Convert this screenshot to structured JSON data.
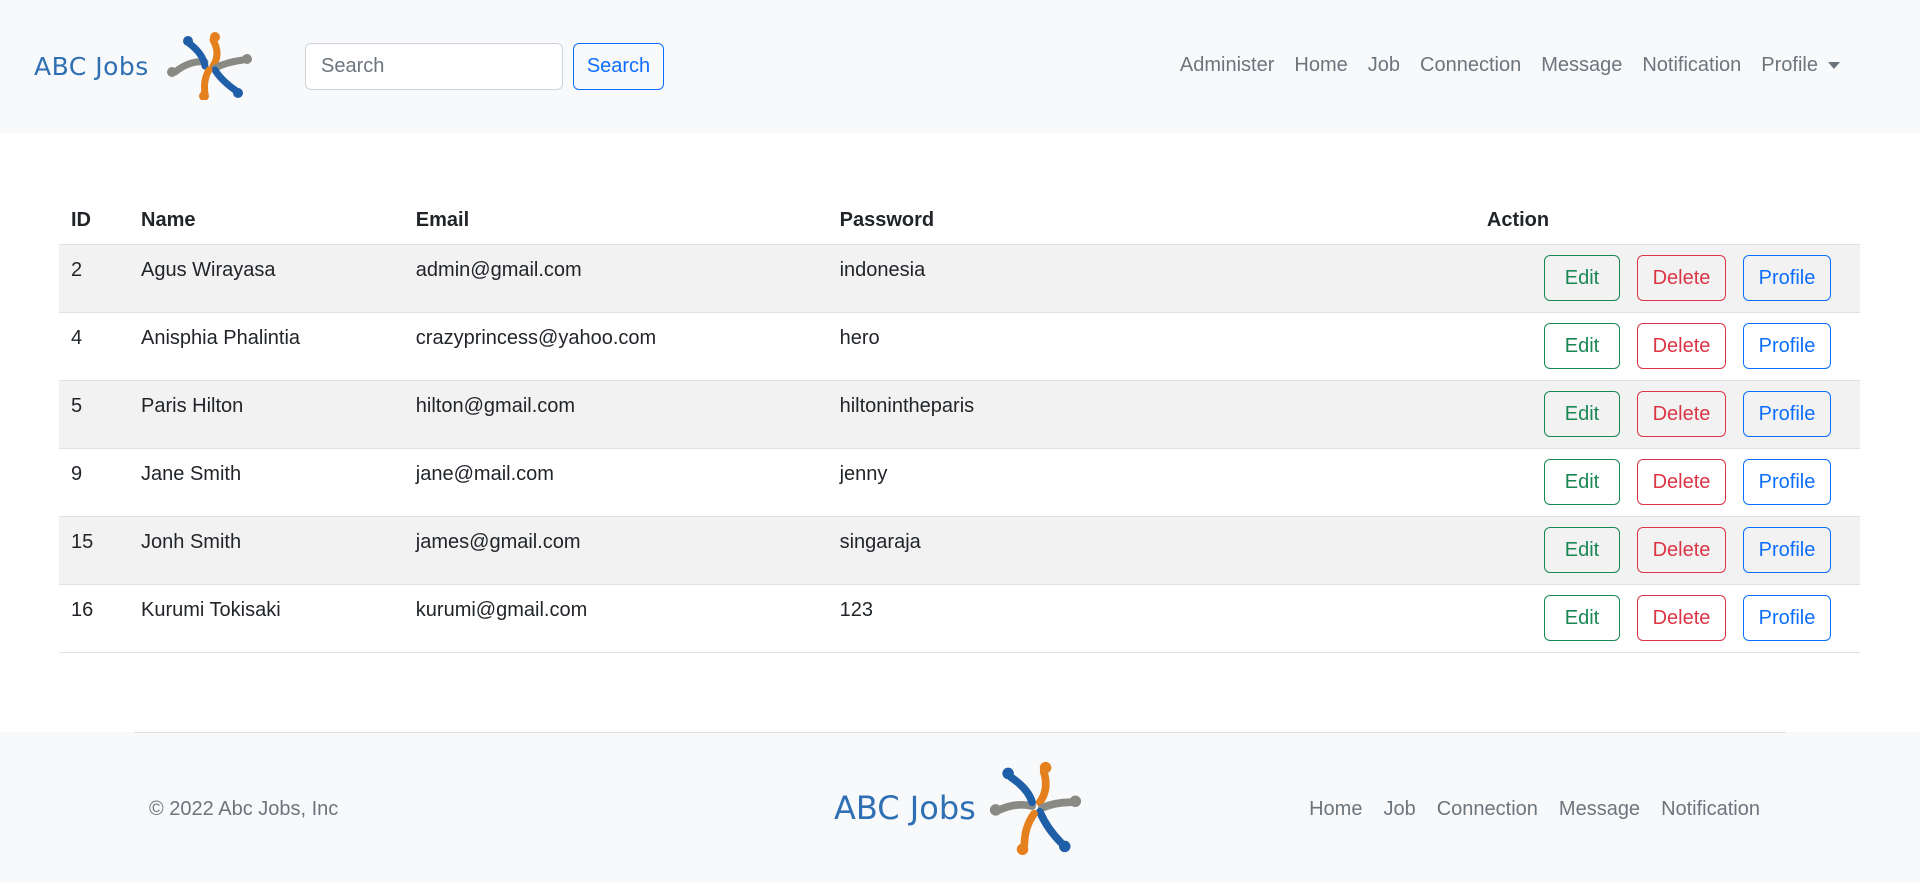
{
  "navbar": {
    "brand": "ABC Jobs",
    "logo_icon": "people-circle-logo-icon",
    "search_placeholder": "Search",
    "search_button": "Search",
    "links": [
      "Administer",
      "Home",
      "Job",
      "Connection",
      "Message",
      "Notification"
    ],
    "profile_dropdown": "Profile"
  },
  "table": {
    "headers": {
      "id": "ID",
      "name": "Name",
      "email": "Email",
      "password": "Password",
      "action": "Action"
    },
    "rows": [
      {
        "id": "2",
        "name": "Agus Wirayasa",
        "email": "admin@gmail.com",
        "password": "indonesia"
      },
      {
        "id": "4",
        "name": "Anisphia Phalintia",
        "email": "crazyprincess@yahoo.com",
        "password": "hero"
      },
      {
        "id": "5",
        "name": "Paris Hilton",
        "email": "hilton@gmail.com",
        "password": "hiltonintheparis"
      },
      {
        "id": "9",
        "name": "Jane Smith",
        "email": "jane@mail.com",
        "password": "jenny"
      },
      {
        "id": "15",
        "name": "Jonh Smith",
        "email": "james@gmail.com",
        "password": "singaraja"
      },
      {
        "id": "16",
        "name": "Kurumi Tokisaki",
        "email": "kurumi@gmail.com",
        "password": "123"
      }
    ],
    "buttons": {
      "edit": "Edit",
      "delete": "Delete",
      "profile": "Profile"
    }
  },
  "footer": {
    "copyright": "© 2022 Abc Jobs, Inc",
    "brand": "ABC Jobs",
    "links": [
      "Home",
      "Job",
      "Connection",
      "Message",
      "Notification"
    ]
  },
  "colors": {
    "brand_blue": "#2f6fb4",
    "logo_orange": "#e5801f",
    "logo_gray": "#8a8a85",
    "primary": "#0d6efd",
    "success": "#198754",
    "danger": "#dc3545",
    "muted": "#6c757d"
  }
}
